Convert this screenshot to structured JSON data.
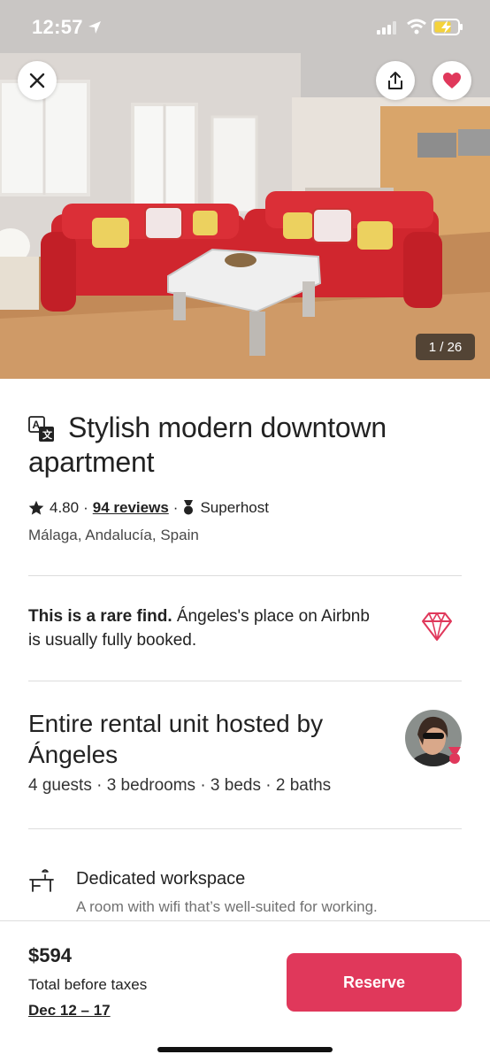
{
  "status_bar": {
    "time": "12:57"
  },
  "gallery": {
    "counter": "1 / 26"
  },
  "header_buttons": {
    "close_icon": "close-icon",
    "share_icon": "share-icon",
    "favorite_icon": "heart-icon"
  },
  "listing": {
    "title": "Stylish modern downtown apartment",
    "rating": "4.80",
    "reviews": "94 reviews",
    "host_badge": "Superhost",
    "location": "Málaga, Andalucía, Spain"
  },
  "rare_find": {
    "bold": "This is a rare find.",
    "text": " Ángeles's place on Airbnb is usually fully booked."
  },
  "host": {
    "title": "Entire rental unit hosted by Ángeles",
    "details": "4 guests · 3 bedrooms · 3 beds · 2 baths"
  },
  "amenity": {
    "title": "Dedicated workspace",
    "description": "A room with wifi that’s well-suited for working."
  },
  "footer": {
    "price": "$594",
    "price_note": "Total before taxes",
    "dates": "Dec 12 – 17",
    "reserve_label": "Reserve"
  },
  "colors": {
    "brand": "#e0385b",
    "heart": "#e0385b"
  }
}
